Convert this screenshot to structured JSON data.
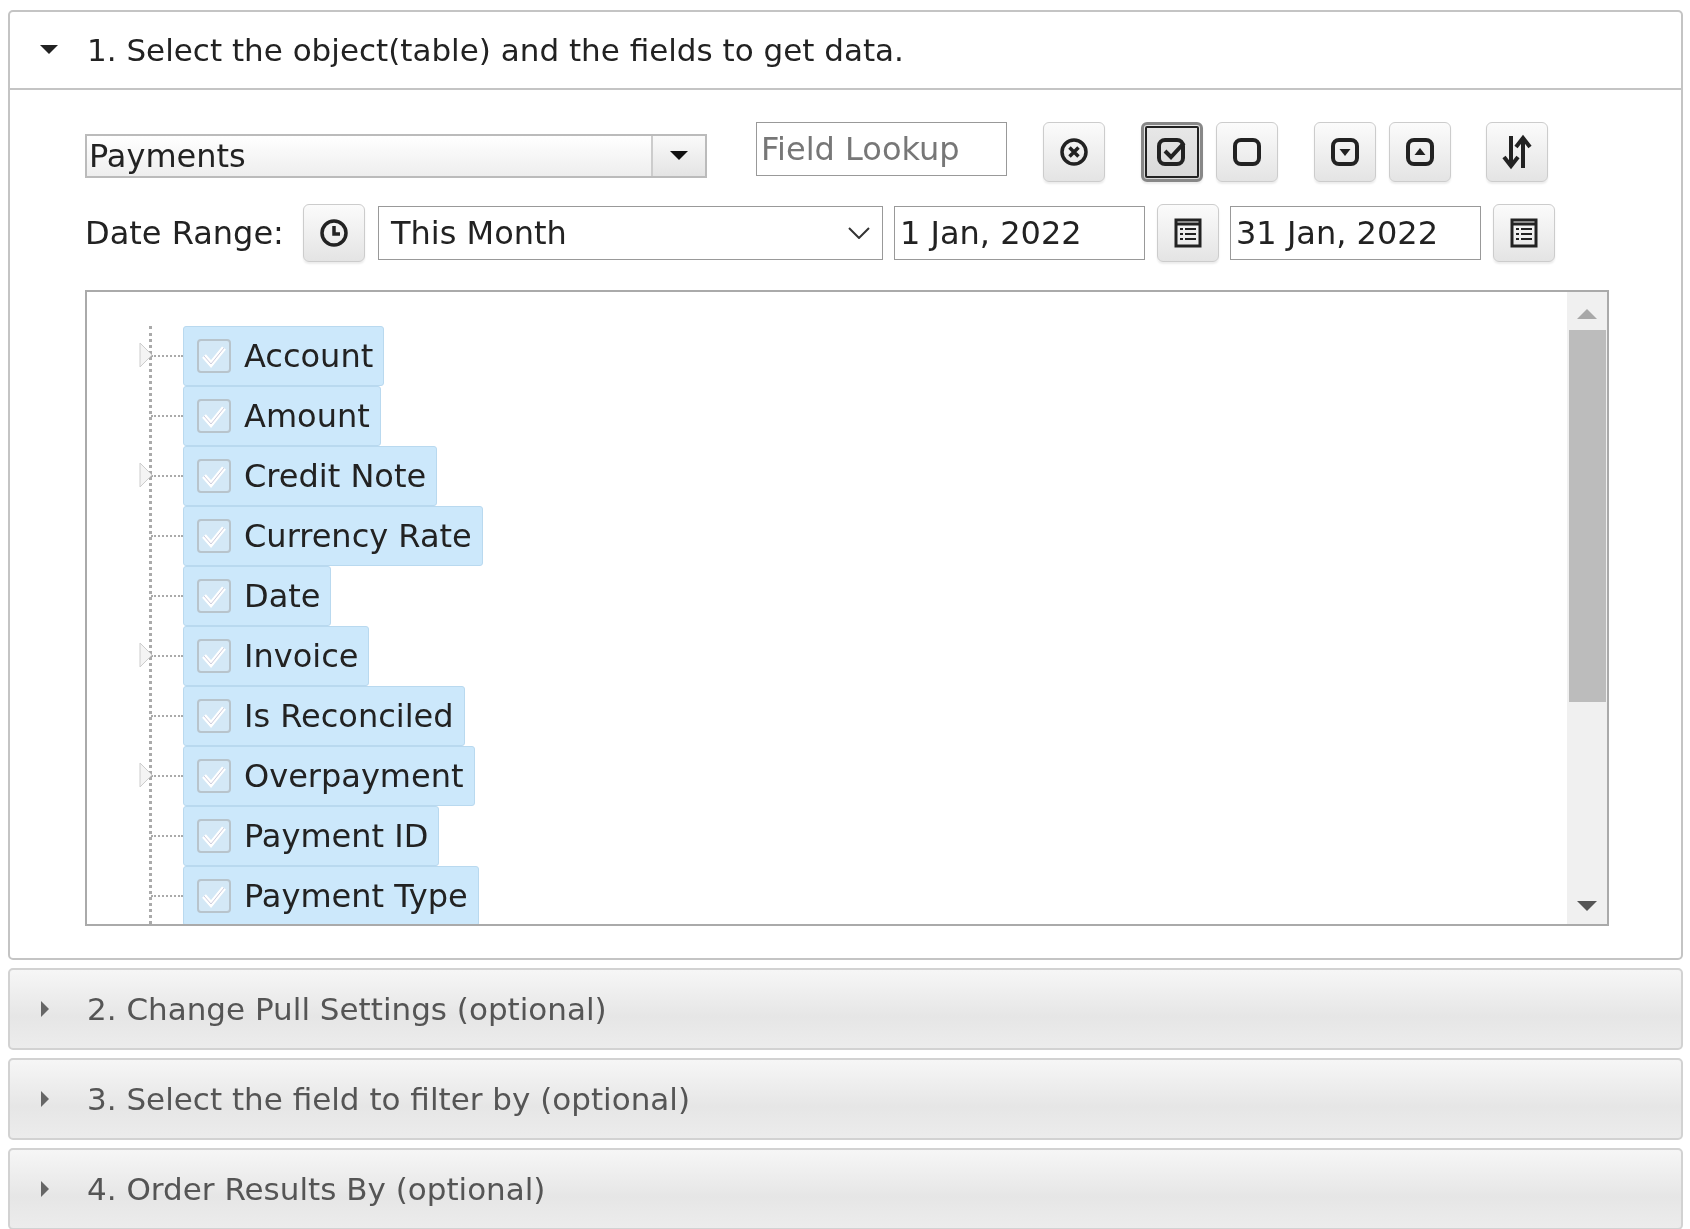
{
  "sections": [
    {
      "title": "1. Select the object(table) and the fields to get data.",
      "expanded": true
    },
    {
      "title": "2. Change Pull Settings (optional)",
      "expanded": false
    },
    {
      "title": "3. Select the field to filter by (optional)",
      "expanded": false
    },
    {
      "title": "4. Order Results By (optional)",
      "expanded": false
    }
  ],
  "object_select": {
    "value": "Payments"
  },
  "field_lookup": {
    "placeholder": "Field Lookup"
  },
  "toolbar_buttons": [
    {
      "kind": "clear",
      "pressed": false
    },
    {
      "kind": "check-all",
      "pressed": true
    },
    {
      "kind": "uncheck-all",
      "pressed": false
    },
    {
      "kind": "expand-all",
      "pressed": false
    },
    {
      "kind": "collapse-all",
      "pressed": false
    },
    {
      "kind": "sort",
      "pressed": false
    }
  ],
  "date_range": {
    "label": "Date Range:",
    "preset": "This Month",
    "from": "1 Jan, 2022",
    "to": "31 Jan, 2022"
  },
  "fields": [
    {
      "label": "Account",
      "checked": true,
      "has_children": true
    },
    {
      "label": "Amount",
      "checked": true,
      "has_children": false
    },
    {
      "label": "Credit Note",
      "checked": true,
      "has_children": true
    },
    {
      "label": "Currency Rate",
      "checked": true,
      "has_children": false
    },
    {
      "label": "Date",
      "checked": true,
      "has_children": false
    },
    {
      "label": "Invoice",
      "checked": true,
      "has_children": true
    },
    {
      "label": "Is Reconciled",
      "checked": true,
      "has_children": false
    },
    {
      "label": "Overpayment",
      "checked": true,
      "has_children": true
    },
    {
      "label": "Payment ID",
      "checked": true,
      "has_children": false
    },
    {
      "label": "Payment Type",
      "checked": true,
      "has_children": false
    }
  ]
}
